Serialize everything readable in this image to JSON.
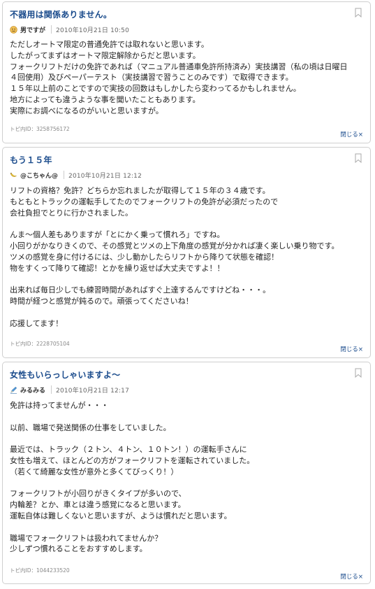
{
  "posts": [
    {
      "title": "不器用は関係ありません。",
      "author": "男ですが",
      "avatar_icon": "face-avatar-icon",
      "date": "2010年10月21日 10:50",
      "lines": [
        "ただしオートマ限定の普通免許では取れないと思います。",
        "したがってまずはオートマ限定解除からだと思います。",
        "フォークリフトだけの免許であれば（マニュアル普通車免許所持済み）実技講習（私の頃は日曜日",
        "４回使用）及びペーパーテスト（実技講習で習うことのみです）で取得できます。",
        "１５年以上前のことですので実技の回数はもしかしたら変わってるかもしれません。",
        "地方によっても違うような事を聞いたこともあります。",
        "実際にお調べになるのがいいと思いますが。"
      ],
      "topic_id": "トピ内ID：3258756172",
      "close_label": "閉じる×"
    },
    {
      "title": "もう１５年",
      "author": "@こちゃん@",
      "avatar_icon": "banana-avatar-icon",
      "date": "2010年10月21日 12:12",
      "lines": [
        "リフトの資格？免許？どちらか忘れましたが取得して１５年の３４歳です。",
        "もともとトラックの運転手してたのでフォークリフトの免許が必須だったので",
        "会社負担でとりに行かされました。",
        "",
        "んま～個人差もありますが「とにかく乗って慣れろ」ですね。",
        "小回りがかなりきくので、その感覚とツメの上下角度の感覚が分かれば凄く楽しい乗り物です。",
        "ツメの感覚を身に付けるには、少し動かしたらリフトから降りて状態を確認！",
        "物をすくって降りて確認！とかを繰り返せば大丈夫ですよ！！",
        "",
        "出来れば毎日少しでも練習時間があればすぐ上達するんですけどね・・・。",
        "時間が経つと感覚が鈍るので。頑張ってくださいね！",
        "",
        "応援してます！"
      ],
      "topic_id": "トピ内ID：2228705104",
      "close_label": "閉じる×"
    },
    {
      "title": "女性もいらっしゃいますよ～",
      "author": "みるみる",
      "avatar_icon": "pen-avatar-icon",
      "date": "2010年10月21日 12:17",
      "lines": [
        "免許は持ってませんが・・・",
        "",
        "以前、職場で発送関係の仕事をしていました。",
        "",
        "最近では、トラック（２トン、４トン、１０トン！）の運転手さんに",
        "女性も増えて、ほとんどの方がフォークリフトを運転されていました。",
        "（若くて綺麗な女性が意外と多くてびっくり！）",
        "",
        "フォークリフトが小回りがきくタイプが多いので、",
        "内輪差？とか、車とは違う感覚になると思います。",
        "運転自体は難しくないと思いますが、ようは慣れだと思います。",
        "",
        "職場でフォークリフトは扱われてませんか？",
        "少しずつ慣れることをおすすめします。"
      ],
      "topic_id": "トピ内ID：1044233520",
      "close_label": "閉じる×"
    }
  ]
}
